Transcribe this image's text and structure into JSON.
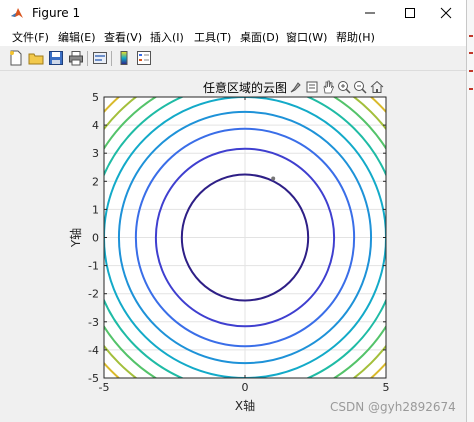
{
  "window": {
    "title": "Figure 1",
    "minimize_glyph": "—",
    "maximize_glyph": "☐",
    "close_glyph": "✕"
  },
  "menu": {
    "items": [
      "文件(F)",
      "编辑(E)",
      "查看(V)",
      "插入(I)",
      "工具(T)",
      "桌面(D)",
      "窗口(W)",
      "帮助(H)"
    ]
  },
  "toolbar": {
    "icons": [
      "new-figure-icon",
      "open-file-icon",
      "save-icon",
      "print-icon",
      "link-plot-icon",
      "insert-colorbar-icon",
      "insert-legend-icon"
    ]
  },
  "axes_toolbar": {
    "icons": [
      "brush-icon",
      "data-tips-icon",
      "pan-hand-icon",
      "zoom-in-icon",
      "zoom-out-icon",
      "home-icon"
    ]
  },
  "chart_data": {
    "type": "contour",
    "title": "任意区域的云图",
    "xlabel": "X轴",
    "ylabel": "Y轴",
    "xlim": [
      -5,
      5
    ],
    "ylim": [
      -5,
      5
    ],
    "xticks": [
      -5,
      0,
      5
    ],
    "yticks": [
      -5,
      -4,
      -3,
      -2,
      -1,
      0,
      1,
      2,
      3,
      4,
      5
    ],
    "grid": true,
    "function": "x^2 + y^2",
    "levels": [
      {
        "radius": 2.24,
        "color": "#2e1f86"
      },
      {
        "radius": 3.16,
        "color": "#3f3fcf"
      },
      {
        "radius": 3.87,
        "color": "#3a6ee8"
      },
      {
        "radius": 4.47,
        "color": "#1e92d8"
      },
      {
        "radius": 5.0,
        "color": "#13aac8"
      },
      {
        "radius": 5.48,
        "color": "#1fbba5"
      },
      {
        "radius": 5.92,
        "color": "#54c36a"
      },
      {
        "radius": 6.32,
        "color": "#a3bf3b"
      },
      {
        "radius": 6.71,
        "color": "#d9b92b"
      }
    ],
    "marker": {
      "x": 1.0,
      "y": 2.1
    }
  },
  "watermark": "CSDN @gyh2892674",
  "colors": {
    "titlebar_bg": "#ffffff",
    "figure_bg": "#f0f0f0",
    "axes_bg": "#ffffff"
  }
}
